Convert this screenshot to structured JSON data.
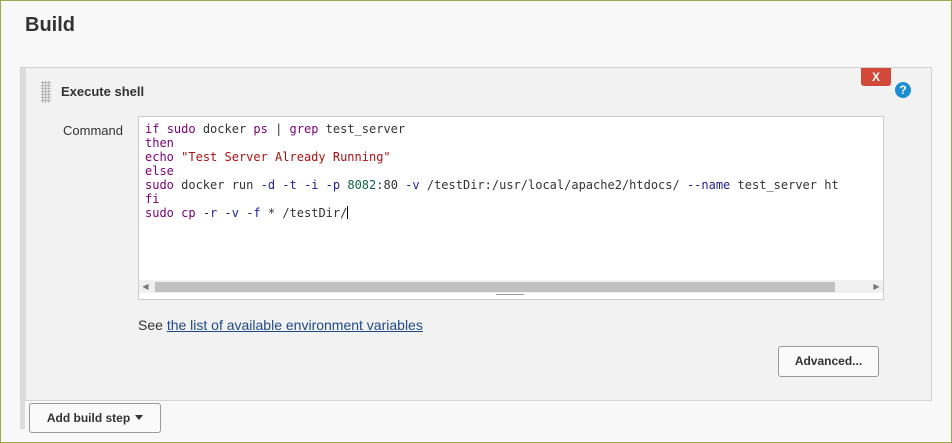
{
  "section": {
    "title": "Build"
  },
  "step": {
    "title": "Execute shell",
    "delete_label": "X",
    "help_label": "?",
    "command_label": "Command",
    "command_lines": [
      "if sudo docker ps | grep test_server",
      "then",
      "echo \"Test Server Already Running\"",
      "else",
      "sudo docker run -d -t -i -p 8082:80 -v /testDir:/usr/local/apache2/htdocs/ --name test_server ht",
      "fi",
      "sudo cp -r -v -f * /testDir/"
    ],
    "env_prefix": "See",
    "env_link": "the list of available environment variables",
    "advanced_label": "Advanced..."
  },
  "footer": {
    "add_build_step_label": "Add build step"
  },
  "colors": {
    "delete": "#d24939",
    "help": "#1b8dd3",
    "link": "#204a87",
    "frame_border": "#9fa84a"
  },
  "icons": {
    "drag_handle": "grip-icon",
    "help": "question-icon",
    "dropdown": "caret-down-icon"
  }
}
